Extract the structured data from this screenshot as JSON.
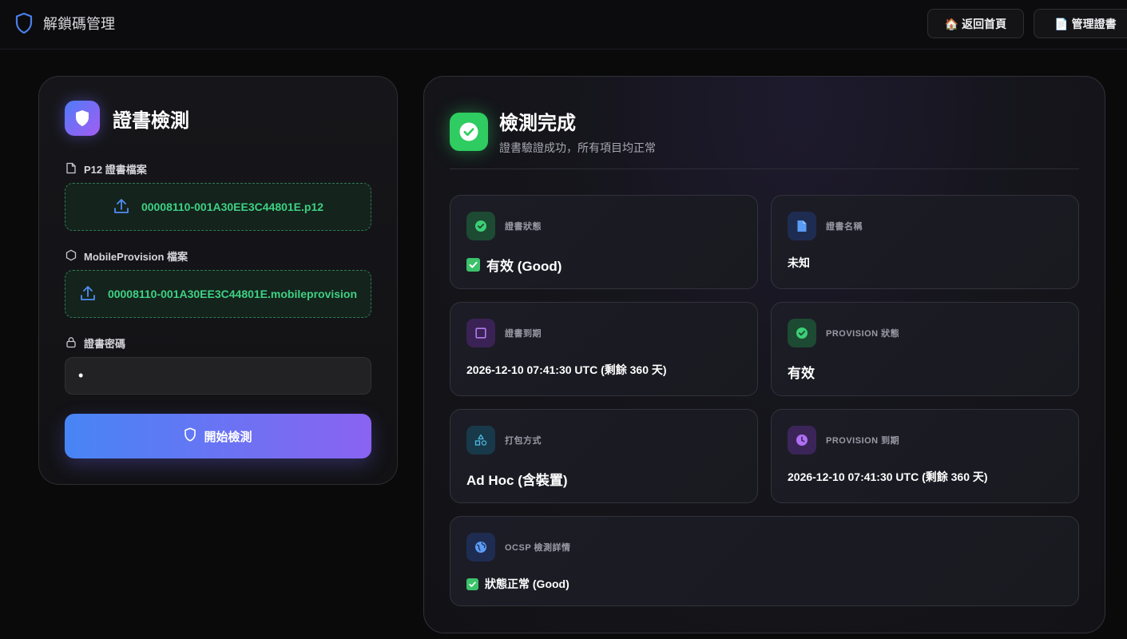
{
  "app": {
    "title": "解鎖碼管理"
  },
  "nav": {
    "home_label": "🏠 返回首頁",
    "cert_label": "📄 管理證書"
  },
  "left_panel": {
    "title": "證書檢測",
    "p12_label": "P12 證書檔案",
    "p12_file": "00008110-001A30EE3C44801E.p12",
    "mp_label": "MobileProvision 檔案",
    "mp_file": "00008110-001A30EE3C44801E.mobileprovision",
    "password_label": "證書密碼",
    "password_value": "•",
    "start_label": "開始檢測"
  },
  "result": {
    "title": "檢測完成",
    "subtitle": "證書驗證成功，所有項目均正常",
    "cards": {
      "cert_status": {
        "label": "證書狀態",
        "value": "有效 (Good)"
      },
      "cert_name": {
        "label": "證書名稱",
        "value": "未知"
      },
      "cert_expiry": {
        "label": "證書到期",
        "value": "2026-12-10 07:41:30 UTC (剩餘 360 天)"
      },
      "provision_status": {
        "label": "PROVISION 狀態",
        "value": "有效"
      },
      "packaging": {
        "label": "打包方式",
        "value": "Ad Hoc (含裝置)"
      },
      "provision_expiry": {
        "label": "PROVISION 到期",
        "value": "2026-12-10 07:41:30 UTC (剩餘 360 天)"
      },
      "ocsp": {
        "label": "OCSP 檢測詳情",
        "value": "狀態正常 (Good)"
      }
    }
  },
  "colors": {
    "accent_green": "#2ecc61",
    "accent_blue": "#4785f5",
    "accent_purple": "#8a63f2",
    "file_text": "#3ed184"
  },
  "icons": [
    "shield-icon",
    "file-icon",
    "upload-icon",
    "cube-icon",
    "lock-icon",
    "check-circle-icon",
    "document-icon",
    "square-icon",
    "shapes-icon",
    "clock-icon",
    "globe-icon",
    "checkbox-emoji-icon"
  ]
}
